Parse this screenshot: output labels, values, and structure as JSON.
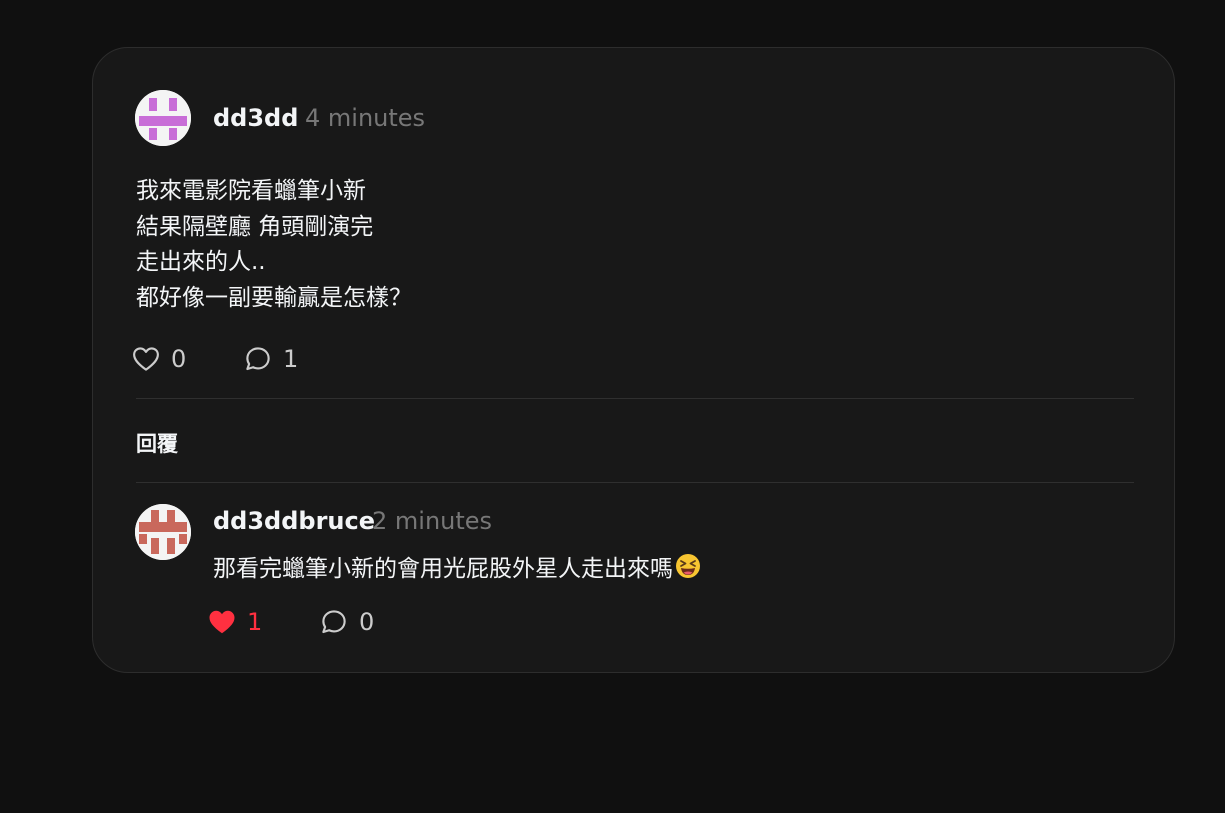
{
  "post": {
    "username": "dd3dd",
    "time": "4 minutes",
    "lines": [
      "我來電影院看蠟筆小新",
      "結果隔壁廳 角頭剛演完",
      "走出來的人..",
      "都好像一副要輸贏是怎樣？"
    ],
    "likes": "0",
    "comments": "1",
    "avatar_color": "#c86dd7"
  },
  "replies_section": {
    "title": "回覆"
  },
  "reply": {
    "username": "dd3ddbruce",
    "time": "2 minutes",
    "text": "那看完蠟筆小新的會用光屁股外星人走出來嗎",
    "emoji": "grinning-squinting-face",
    "likes": "1",
    "liked": true,
    "comments": "0",
    "avatar_color": "#c9685c"
  },
  "colors": {
    "background": "#101010",
    "card": "#181818",
    "liked": "#ff3040",
    "muted": "#777777"
  }
}
